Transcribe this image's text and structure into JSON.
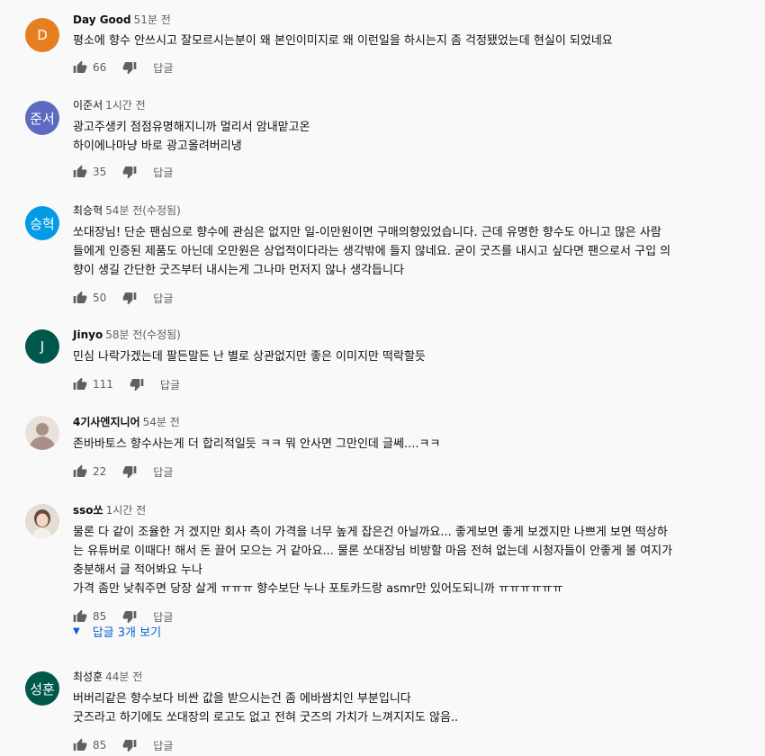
{
  "comments": [
    {
      "avatar_text": "D",
      "avatar_color": "#e67e22",
      "author": "Day Good",
      "time": "51분 전",
      "edited": "",
      "text": "평소에 향수 안쓰시고 잘모르시는분이 왜 본인이미지로 왜 이런일을 하시는지 좀 걱정됐었는데 현실이 되었네요",
      "likes": "66",
      "reply_label": "답글"
    },
    {
      "avatar_text": "준서",
      "avatar_color": "#5c6bc0",
      "author": "이준서",
      "time": "1시간 전",
      "edited": "",
      "text": "광고주생키 점점유명해지니까 멀리서 암내맡고온\n하이에나마냥 바로 광고올려버리냉",
      "likes": "35",
      "reply_label": "답글"
    },
    {
      "avatar_text": "승혁",
      "avatar_color": "#039be5",
      "author": "최승혁",
      "time": "54분 전",
      "edited": "(수정됨)",
      "text": "쏘대장님! 단순 팬심으로 향수에 관심은 없지만 일-이만원이면 구매의향있었습니다. 근데 유명한 향수도 아니고 많은 사람\n들에게 인증된 제품도 아닌데 오만원은 상업적이다라는 생각밖에 들지 않네요. 굳이 굿즈를 내시고 싶다면 팬으로서 구입 의\n향이 생길 간단한 굿즈부터 내시는게 그나마 먼저지 않나 생각듭니다",
      "likes": "50",
      "reply_label": "답글"
    },
    {
      "avatar_text": "J",
      "avatar_color": "#00574b",
      "author": "Jinyo",
      "time": "58분 전",
      "edited": "(수정됨)",
      "text": "민심 나락가겠는데 팔든말든 난 별로 상관없지만 좋은 이미지만 떡락할듯",
      "likes": "111",
      "reply_label": "답글"
    },
    {
      "avatar_text": "",
      "avatar_color": "#c9b3a8",
      "author": "4기사엔지니어",
      "time": "54분 전",
      "edited": "",
      "text": "존바바토스 향수사는게 더 합리적일듯 ㅋㅋ 뭐 안사면 그만인데 글쎄....ㅋㅋ",
      "likes": "22",
      "reply_label": "답글"
    },
    {
      "avatar_text": "",
      "avatar_color": "#d7ccc0",
      "author": "sso쏘",
      "time": "1시간 전",
      "edited": "",
      "text": "물론 다 같이 조율한 거 겠지만 회사 측이 가격을 너무 높게 잡은건 아닐까요... 좋게보면 좋게 보겠지만 나쁘게 보면 떡상하\n는 유튜버로 이때다! 해서 돈 끌어 모으는 거 같아요... 물론 쏘대장님 비방할 마음 전혀 없는데 시청자들이 안좋게 볼 여지가\n충분해서 글 적어봐요 누나\n가격 좀만 낮춰주면 당장 살게 ㅠㅠㅠ 향수보단 누나 포토카드랑 asmr만 있어도되니까 ㅠㅠㅠㅠㅠㅠ",
      "likes": "85",
      "reply_label": "답글",
      "replies_label": "답글 3개 보기"
    },
    {
      "avatar_text": "성훈",
      "avatar_color": "#00574b",
      "author": "최성훈",
      "time": "44분 전",
      "edited": "",
      "text": "버버리같은 향수보다 비싼 값을 받으시는건 좀 에바쌈치인 부분입니다\n굿즈라고 하기에도 쏘대장의 로고도 없고 전혀 굿즈의 가치가 느껴지지도 않음..",
      "likes": "85",
      "reply_label": "답글"
    }
  ],
  "icons": {
    "like": "thumb-up-icon",
    "dislike": "thumb-down-icon",
    "expand": "chevron-down-icon"
  }
}
